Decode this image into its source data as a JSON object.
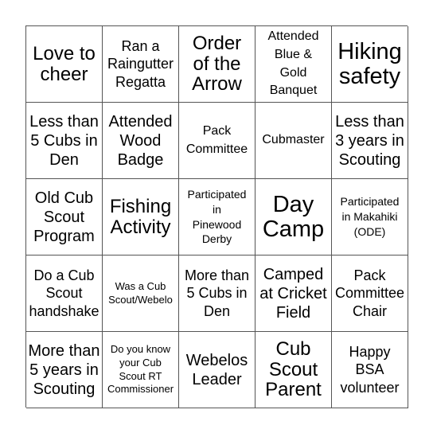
{
  "card": {
    "rows": [
      [
        "Love to\ncheer",
        "Ran a\nRaingutter\nRegatta",
        "Order\nof the\nArrow",
        "Attended\nBlue &\nGold\nBanquet",
        "Hiking\nsafety"
      ],
      [
        "Less than\n5 Cubs in\nDen",
        "Attended\nWood\nBadge",
        "Pack\nCommittee",
        "Cubmaster",
        "Less than\n3 years in\nScouting"
      ],
      [
        "Old Cub\nScout\nProgram",
        "Fishing\nActivity",
        "Participated\nin\nPinewood\nDerby",
        "Day\nCamp",
        "Participated\nin Makahiki\n(ODE)"
      ],
      [
        "Do a Cub\nScout\nhandshake",
        "Was a Cub\nScout/Webelo",
        "More than\n5 Cubs in\nDen",
        "Camped\nat Cricket\nField",
        "Pack\nCommittee\nChair"
      ],
      [
        "More than\n5 years in\nScouting",
        "Do you know\nyour Cub\nScout RT\nCommissioner",
        "Webelos\nLeader",
        "Cub\nScout\nParent",
        "Happy\nBSA\nvolunteer"
      ]
    ]
  }
}
